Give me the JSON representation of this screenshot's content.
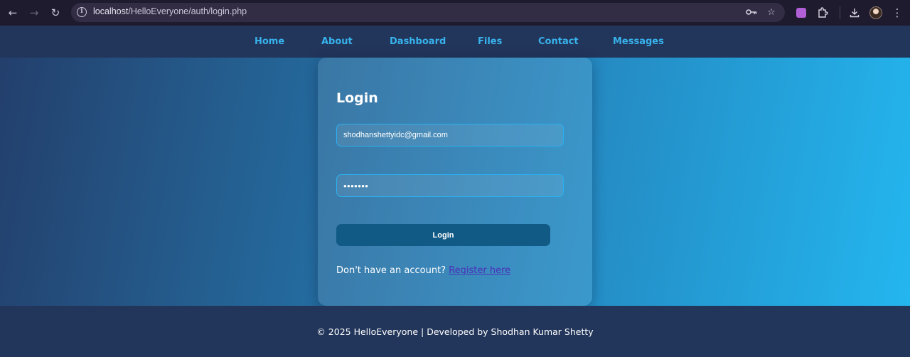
{
  "browser": {
    "url_host": "localhost",
    "url_path": "/HelloEveryone/auth/login.php",
    "icons": {
      "back": "arrow-left-icon",
      "forward": "arrow-right-icon",
      "reload": "reload-icon",
      "site_info": "info-icon",
      "password": "key-icon",
      "bookmark": "star-icon",
      "extension_app": "purple-extension-icon",
      "extensions": "puzzle-icon",
      "downloads": "download-icon",
      "profile": "avatar",
      "menu": "kebab-menu-icon"
    }
  },
  "nav": {
    "items": [
      {
        "label": "Home"
      },
      {
        "label": "About"
      },
      {
        "label": "Dashboard"
      },
      {
        "label": "Files"
      },
      {
        "label": "Contact"
      },
      {
        "label": "Messages"
      }
    ]
  },
  "login": {
    "title": "Login",
    "email_value": "shodhanshettyidc@gmail.com",
    "password_value": "•••••••",
    "button_label": "Login",
    "register_prompt": "Don't have an account?",
    "register_link": "Register here"
  },
  "footer": {
    "text": "© 2025 HelloEveryone | Developed by Shodhan Kumar Shetty"
  },
  "colors": {
    "header_bg": "#22355a",
    "nav_link": "#37b2ec",
    "gradient_start": "#233f6c",
    "gradient_end": "#24b6ef",
    "input_border": "#2ab0f0",
    "button_bg": "#125a86",
    "link": "#4a2fb8"
  }
}
